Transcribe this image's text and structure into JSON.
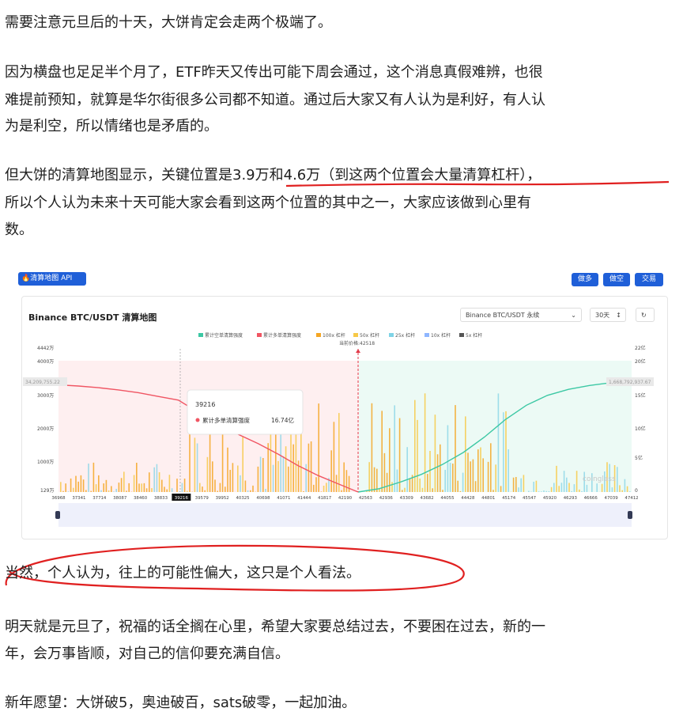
{
  "paragraphs": {
    "p1": "需要注意元旦后的十天，大饼肯定会走两个极端了。",
    "p2a": "因为横盘也足足半个月了，ETF昨天又传出可能下周会通过，这个消息真假难辨，也很",
    "p2b": "难提前预知，就算是华尔街很多公司都不知道。通过后大家又有人认为是利好，有人认",
    "p2c": "为是利空，所以情绪也是矛盾的。",
    "p3a_pre": "但大饼的清算地图显示，关键位置是",
    "p3a_hl": "3.9万和4.6万（到这两个位置会大量清算杠杆），",
    "p3b": "所以个人认为未来十天可能大家会看到这两个位置的其中之一，大家应该做到心里有",
    "p3c": "数。",
    "p4": "当然，个人认为，往上的可能性偏大，这只是个人看法。",
    "p5a": "明天就是元旦了，祝福的话全搁在心里，希望大家要总结过去，不要困在过去，新的一",
    "p5b": "年，会万事皆顺，对自己的信仰要充满自信。",
    "p6": "新年愿望：大饼破5，奥迪破百，sats破零，一起加油。"
  },
  "embed": {
    "api_button": "清算地图 API",
    "buttons": [
      "做多",
      "做空",
      "交易"
    ],
    "title": "Binance BTC/USDT 清算地图",
    "pair_select": "Binance BTC/USDT 永续",
    "range_select": "30天",
    "watermark": "coinglass",
    "tooltip_price": "39216",
    "tooltip_label": "累计多单清算强度",
    "tooltip_value": "16.74亿",
    "current_price_label": "当前价格:42518",
    "left_flag": "34,209,755.22",
    "right_flag": "1,668,792,937.67"
  },
  "colors": {
    "red_line": "#f05563",
    "green_line": "#3cc8a4",
    "orange_bar": "#f5a623",
    "yellow_bar": "#f7c948",
    "cyan_bar": "#7fd3e6",
    "blue_btn": "#1f5fd8",
    "annotation_red": "#e02020"
  },
  "chart_data": {
    "type": "bar",
    "title": "Binance BTC/USDT 清算地图",
    "legend": [
      "累计空单清算强度",
      "累计多单清算强度",
      "100x 杠杆",
      "50x 杠杆",
      "25x 杠杆",
      "10x 杠杆",
      "5x 杠杆"
    ],
    "current_price": 42518,
    "x_ticks": [
      36968,
      37341,
      37714,
      38087,
      38460,
      38833,
      39216,
      39579,
      39952,
      40325,
      40698,
      41071,
      41444,
      41817,
      42190,
      42563,
      42936,
      43309,
      43682,
      44055,
      44428,
      44801,
      45174,
      45547,
      45920,
      46293,
      46666,
      47039,
      47412
    ],
    "highlight_tick": 39216,
    "y_left_ticks": [
      "129万",
      "1000万",
      "2000万",
      "3000万",
      "4000万",
      "4442万"
    ],
    "y_right_ticks": [
      "0",
      "5亿",
      "10亿",
      "15亿",
      "20亿",
      "22亿"
    ],
    "long_cumulative_yi": [
      19.5,
      19.3,
      19.0,
      18.6,
      18.1,
      17.4,
      16.74,
      14.5,
      12.8,
      10.5,
      8.8,
      6.9,
      4.8,
      3.0,
      1.5,
      0.0
    ],
    "short_cumulative_yi": [
      0.0,
      0.6,
      1.8,
      3.2,
      5.0,
      7.2,
      10.0,
      13.2,
      15.8,
      17.6,
      18.7,
      19.4,
      19.9,
      20.2
    ]
  }
}
